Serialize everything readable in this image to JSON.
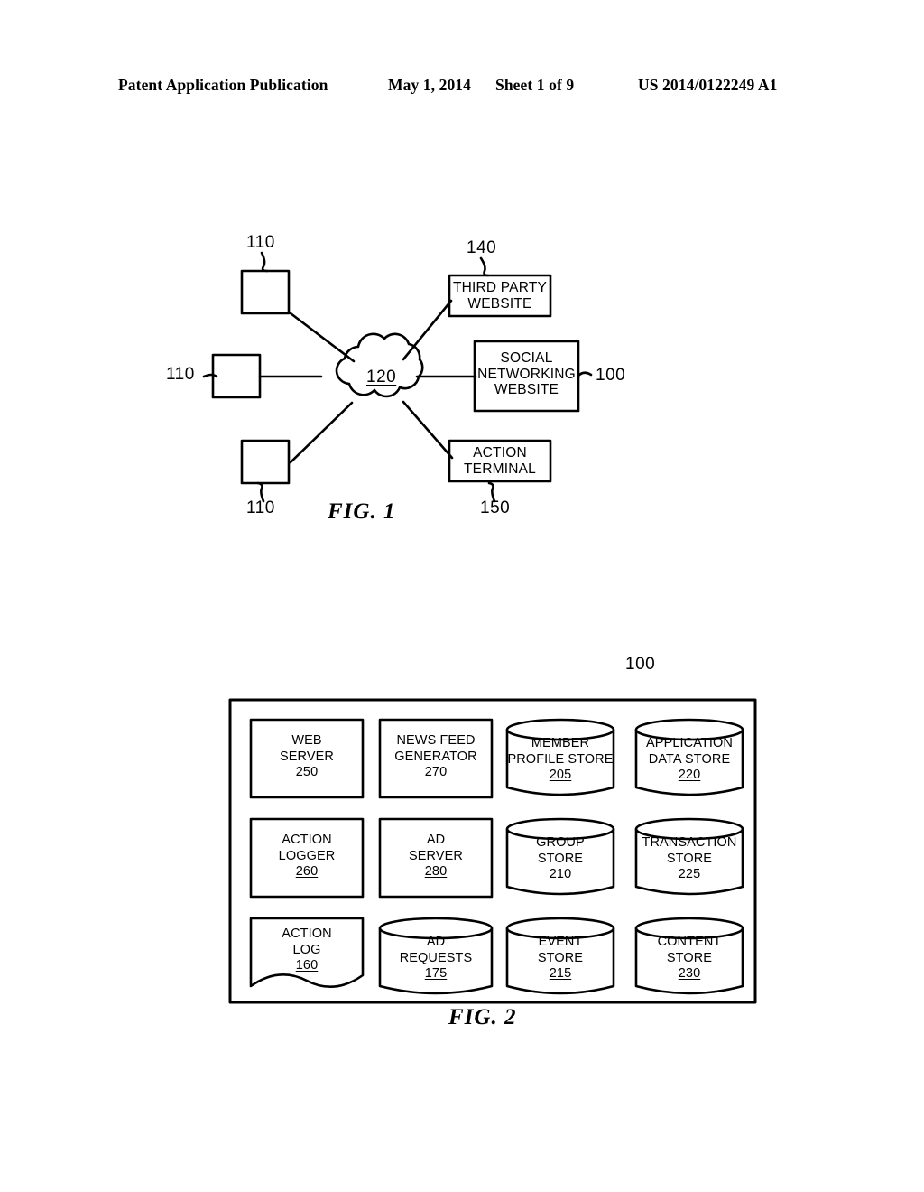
{
  "header": {
    "publication": "Patent Application Publication",
    "date": "May 1, 2014",
    "sheet": "Sheet 1 of 9",
    "patent_number": "US 2014/0122249 A1"
  },
  "figure1": {
    "caption": "FIG. 1",
    "clients": [
      {
        "ref": "110"
      },
      {
        "ref": "110"
      },
      {
        "ref": "110"
      }
    ],
    "network": {
      "ref": "120"
    },
    "nodes": [
      {
        "ref": "140",
        "line1": "THIRD PARTY",
        "line2": "WEBSITE",
        "line3": ""
      },
      {
        "ref": "100",
        "line1": "SOCIAL",
        "line2": "NETWORKING",
        "line3": "WEBSITE"
      },
      {
        "ref": "150",
        "line1": "ACTION",
        "line2": "TERMINAL",
        "line3": ""
      }
    ]
  },
  "figure2": {
    "caption": "FIG. 2",
    "system_ref": "100",
    "cells": [
      {
        "shape": "rect",
        "line1": "WEB",
        "line2": "SERVER",
        "num": "250"
      },
      {
        "shape": "rect",
        "line1": "NEWS FEED",
        "line2": "GENERATOR",
        "num": "270"
      },
      {
        "shape": "cylinder",
        "line1": "MEMBER",
        "line2": "PROFILE STORE",
        "num": "205"
      },
      {
        "shape": "cylinder",
        "line1": "APPLICATION",
        "line2": "DATA STORE",
        "num": "220"
      },
      {
        "shape": "rect",
        "line1": "ACTION",
        "line2": "LOGGER",
        "num": "260"
      },
      {
        "shape": "rect",
        "line1": "AD",
        "line2": "SERVER",
        "num": "280"
      },
      {
        "shape": "cylinder",
        "line1": "GROUP",
        "line2": "STORE",
        "num": "210"
      },
      {
        "shape": "cylinder",
        "line1": "TRANSACTION",
        "line2": "STORE",
        "num": "225"
      },
      {
        "shape": "document",
        "line1": "ACTION",
        "line2": "LOG",
        "num": "160"
      },
      {
        "shape": "cylinder",
        "line1": "AD",
        "line2": "REQUESTS",
        "num": "175"
      },
      {
        "shape": "cylinder",
        "line1": "EVENT",
        "line2": "STORE",
        "num": "215"
      },
      {
        "shape": "cylinder",
        "line1": "CONTENT",
        "line2": "STORE",
        "num": "230"
      }
    ]
  },
  "colors": {
    "ink": "#000000",
    "paper": "#ffffff"
  }
}
